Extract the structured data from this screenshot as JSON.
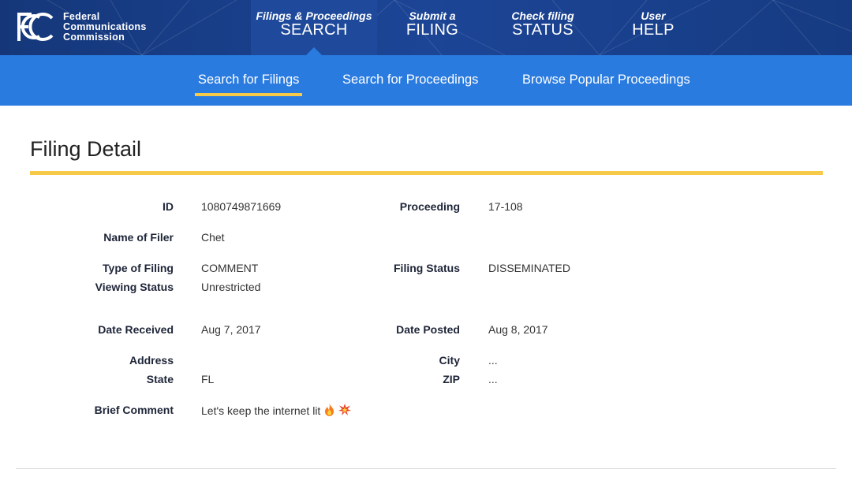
{
  "header": {
    "org_lines": [
      "Federal",
      "Communications",
      "Commission"
    ],
    "nav": [
      {
        "small": "Filings & Proceedings",
        "big": "SEARCH"
      },
      {
        "small": "Submit a",
        "big": "FILING"
      },
      {
        "small": "Check filing",
        "big": "STATUS"
      },
      {
        "small": "User",
        "big": "HELP"
      }
    ]
  },
  "subnav": {
    "tabs": [
      "Search for Filings",
      "Search for Proceedings",
      "Browse Popular Proceedings"
    ]
  },
  "page": {
    "title": "Filing Detail"
  },
  "fields": {
    "id": {
      "label": "ID",
      "value": "1080749871669"
    },
    "proceeding": {
      "label": "Proceeding",
      "value": "17-108"
    },
    "name_of_filer": {
      "label": "Name of Filer",
      "value": "Chet"
    },
    "type_of_filing": {
      "label": "Type of Filing",
      "value": "COMMENT"
    },
    "filing_status": {
      "label": "Filing Status",
      "value": "DISSEMINATED"
    },
    "viewing_status": {
      "label": "Viewing Status",
      "value": "Unrestricted"
    },
    "date_received": {
      "label": "Date Received",
      "value": "Aug 7, 2017"
    },
    "date_posted": {
      "label": "Date Posted",
      "value": "Aug 8, 2017"
    },
    "address": {
      "label": "Address",
      "value": ""
    },
    "city": {
      "label": "City",
      "value": "..."
    },
    "state": {
      "label": "State",
      "value": "FL"
    },
    "zip": {
      "label": "ZIP",
      "value": "..."
    },
    "brief_comment": {
      "label": "Brief Comment",
      "value": "Let's keep the internet lit"
    }
  },
  "icons": {
    "comment_emoji": [
      "fire-icon",
      "collision-icon"
    ]
  },
  "colors": {
    "header_dark": "#15377a",
    "subnav_blue": "#2a7be0",
    "accent_yellow": "#f7c948"
  }
}
